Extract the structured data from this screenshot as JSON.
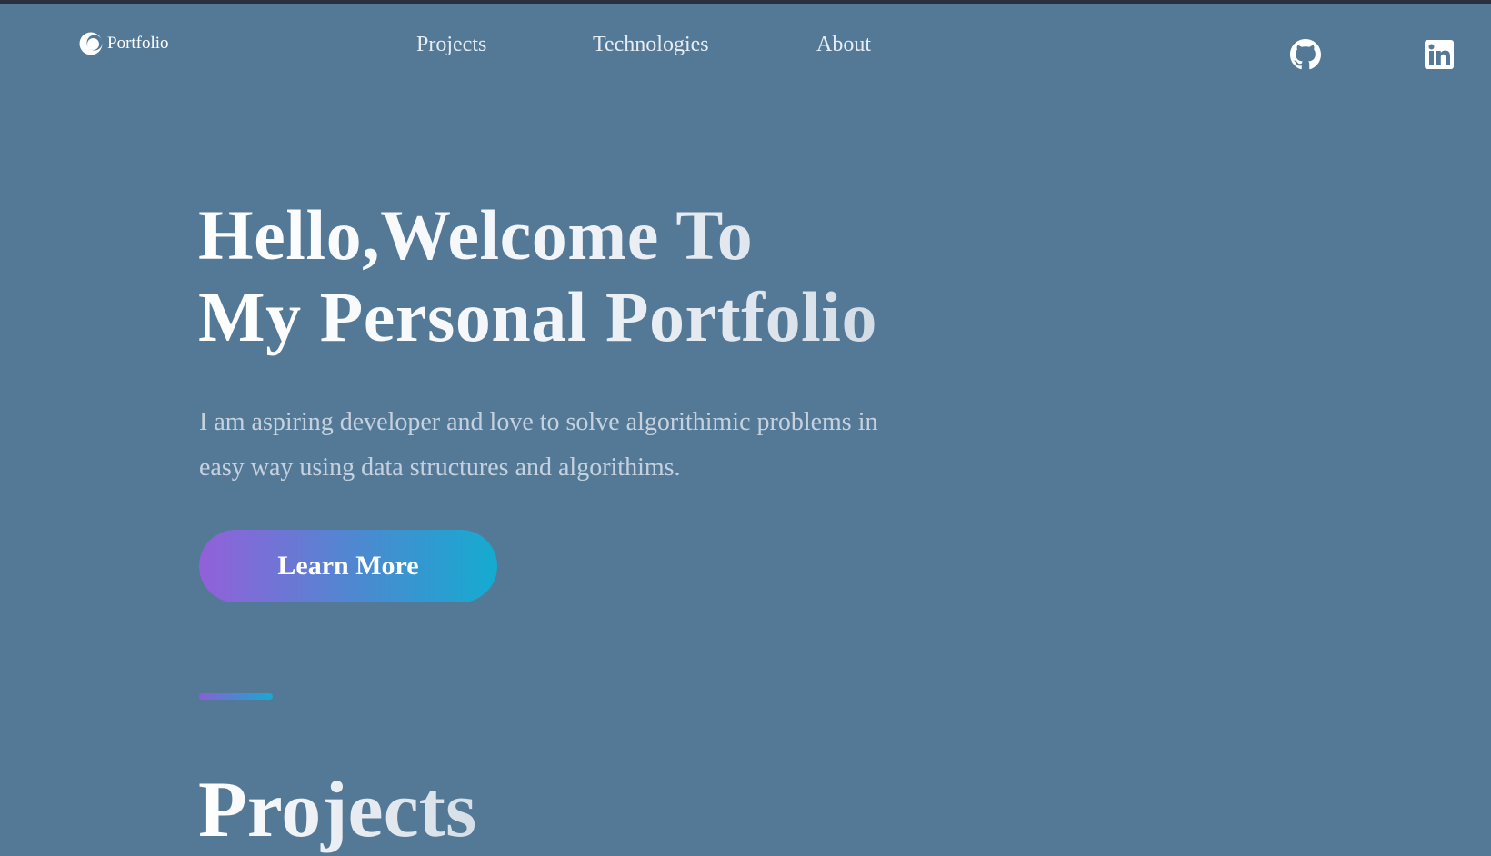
{
  "nav": {
    "brand": "Portfolio",
    "brand_icon": "crescent-logo-icon",
    "links": [
      {
        "label": "Projects"
      },
      {
        "label": "Technologies"
      },
      {
        "label": "About"
      }
    ],
    "social": [
      {
        "icon": "github-icon"
      },
      {
        "icon": "linkedin-icon"
      }
    ]
  },
  "hero": {
    "title_line1": "Hello,Welcome To",
    "title_line2": "My Personal Portfolio",
    "description": "I am aspiring developer and love to solve algorithimic problems in easy way using data structures and algorithims.",
    "cta_label": "Learn More"
  },
  "projects": {
    "heading": "Projects"
  },
  "colors": {
    "background": "#547996",
    "accent_start": "#9360da",
    "accent_end": "#14abd0",
    "text": "#ffffff"
  }
}
